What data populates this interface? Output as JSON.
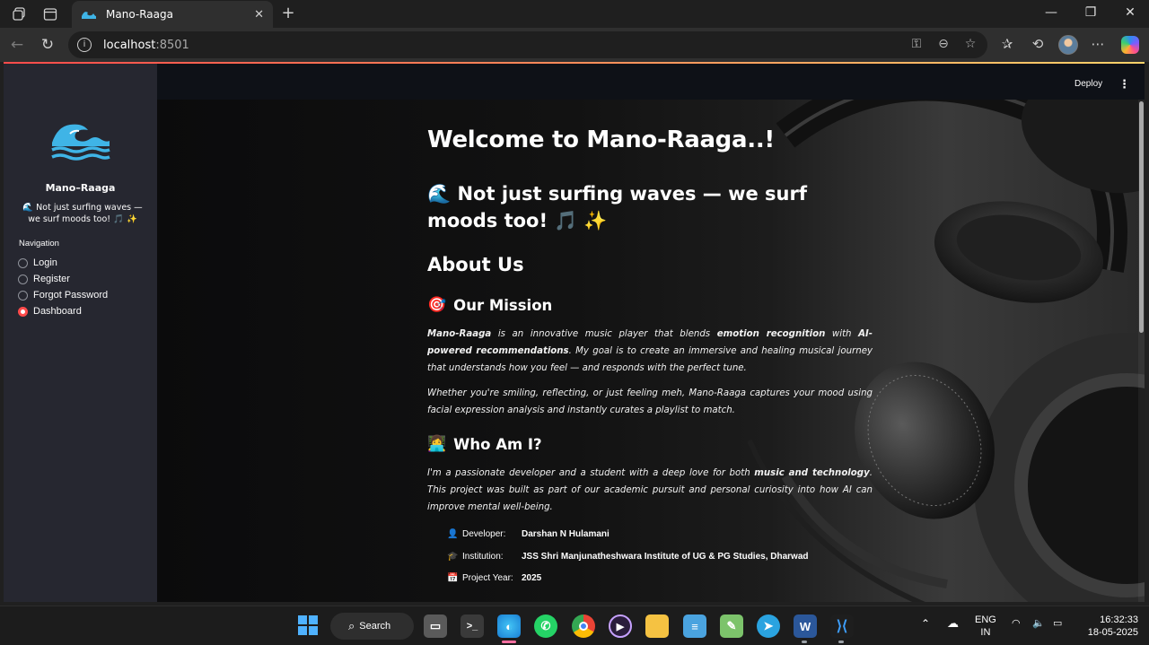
{
  "browser": {
    "tab_title": "Mano-Raaga",
    "url_host": "localhost",
    "url_port": ":8501"
  },
  "app": {
    "deploy_label": "Deploy",
    "menu_glyph": "⋮",
    "sidebar": {
      "app_name": "Mano–Raaga",
      "tagline": "🌊 Not just surfing waves — we surf moods too! 🎵 ✨",
      "nav_label": "Navigation",
      "nav_items": [
        {
          "label": "Login",
          "selected": false
        },
        {
          "label": "Register",
          "selected": false
        },
        {
          "label": "Forgot Password",
          "selected": false
        },
        {
          "label": "Dashboard",
          "selected": true
        }
      ]
    },
    "main": {
      "title": "Welcome to Mano-Raaga..!",
      "subtitle_icon": "🌊",
      "subtitle_text": "Not just surfing waves — we surf moods too!",
      "subtitle_trailing": "🎵 ✨",
      "about_heading": "About Us",
      "mission": {
        "icon": "🎯",
        "heading": "Our Mission",
        "p1_name": "Mano-Raaga",
        "p1_a": " is an innovative music player that blends ",
        "p1_b": "emotion recognition",
        "p1_c": " with ",
        "p1_d": "AI-powered recommendations",
        "p1_e": ". My goal is to create an immersive and healing musical journey that understands how you feel — and responds with the perfect tune.",
        "p2": "Whether you're smiling, reflecting, or just feeling meh, Mano-Raaga captures your mood using facial expression analysis and instantly curates a playlist to match."
      },
      "whoami": {
        "icon": "👩‍💻",
        "heading": "Who Am I?",
        "p_a": "I'm a passionate developer and a student with a deep love for both ",
        "p_b": "music and technology",
        "p_c": ". This project was built as part of our academic pursuit and personal curiosity into how AI can improve mental well-being."
      },
      "info": [
        {
          "icon": "👤",
          "key": "Developer:",
          "value": "Darshan N Hulamani"
        },
        {
          "icon": "🎓",
          "key": "Institution:",
          "value": "JSS Shri Manjunatheshwara Institute of UG & PG Studies, Dharwad"
        },
        {
          "icon": "📅",
          "key": "Project Year:",
          "value": "2025"
        }
      ]
    }
  },
  "taskbar": {
    "search_label": "Search",
    "lang_line1": "ENG",
    "lang_line2": "IN",
    "time": "16:32:33",
    "date": "18-05-2025"
  },
  "colors": {
    "accent": "#ff4b4b",
    "sidebar_bg": "#262730",
    "app_bg": "#0e1117",
    "wave_blue": "#3fb4e6"
  }
}
